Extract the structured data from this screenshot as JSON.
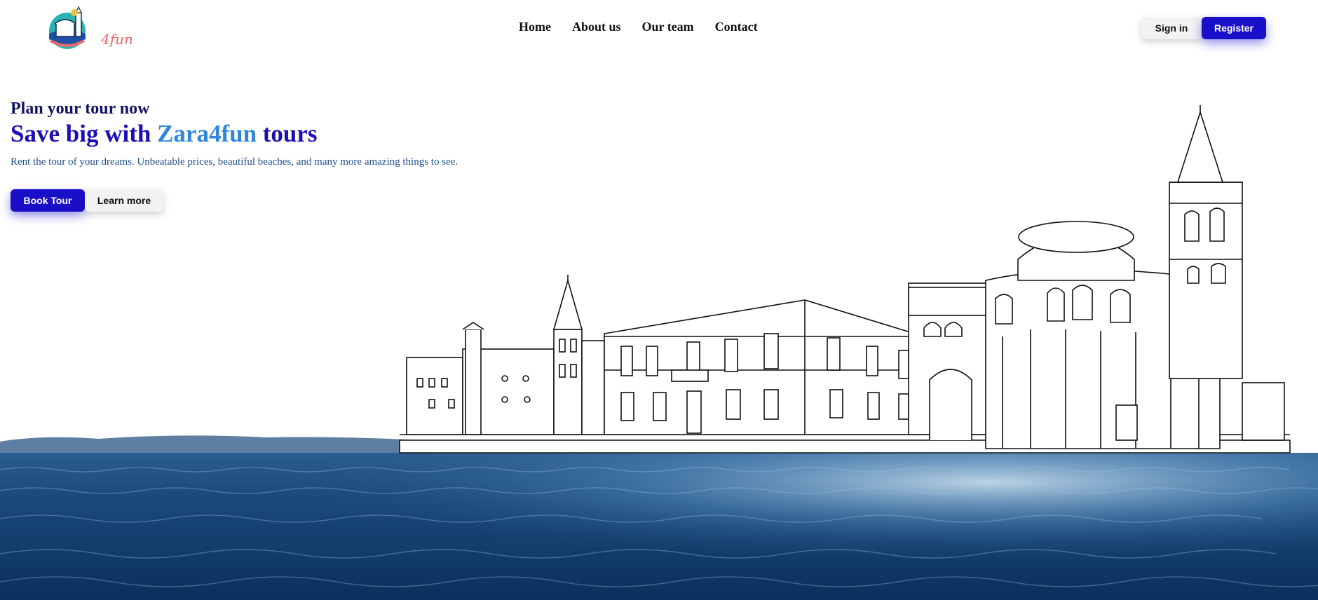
{
  "brand": {
    "logo_text": "4fun"
  },
  "nav": {
    "items": [
      {
        "label": "Home"
      },
      {
        "label": "About us"
      },
      {
        "label": "Our team"
      },
      {
        "label": "Contact"
      }
    ]
  },
  "auth": {
    "sign_in": "Sign in",
    "register": "Register"
  },
  "hero": {
    "subtitle": "Plan your tour now",
    "title_prefix": "Save big with ",
    "title_accent": "Zara4fun",
    "title_suffix": " tours",
    "description": "Rent the tour of your dreams. Unbeatable prices, beautiful beaches, and many more amazing things to see.",
    "book_label": "Book Tour",
    "learn_label": "Learn more"
  },
  "colors": {
    "primary": "#1a0fc8",
    "accent": "#2e86de",
    "title": "#1a0fb5",
    "sea_dark": "#0e3566",
    "sea_light": "#6fa8d6"
  }
}
